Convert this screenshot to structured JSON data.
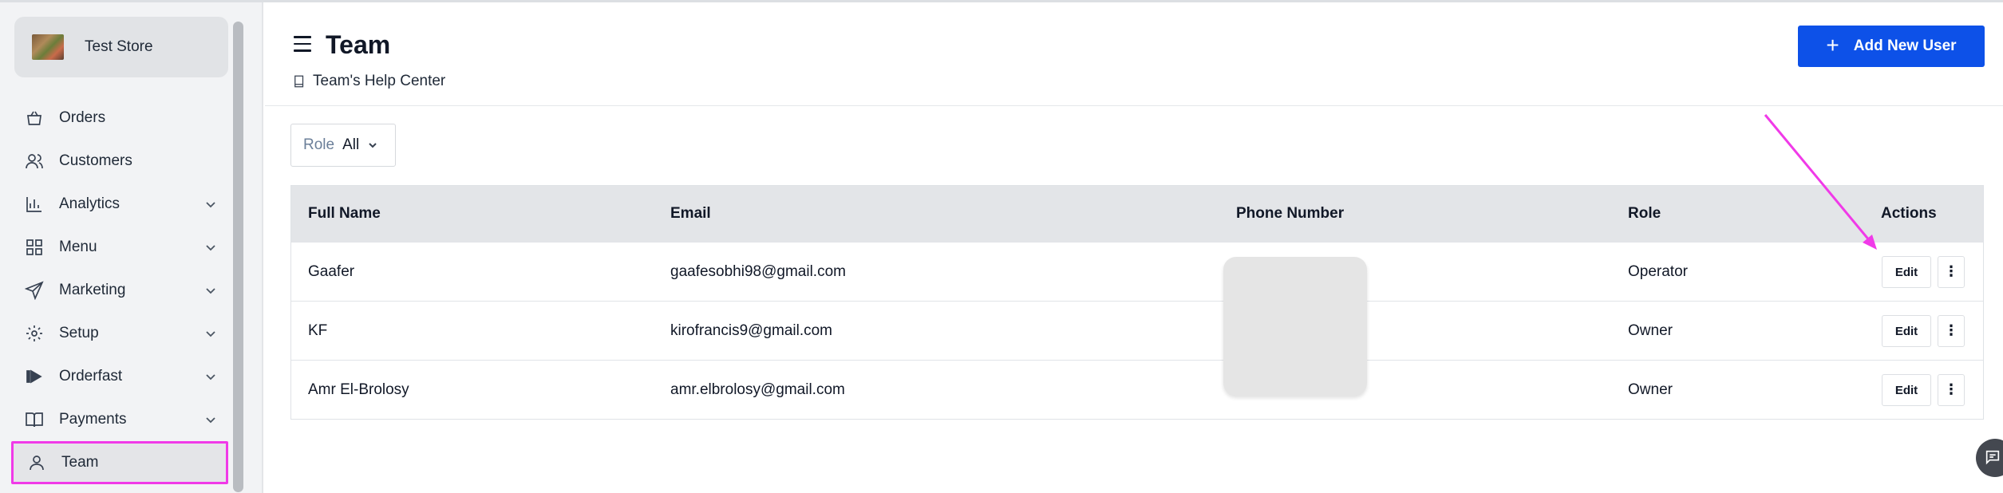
{
  "store": {
    "name": "Test Store"
  },
  "sidebar": {
    "items": [
      {
        "label": "Orders",
        "icon": "shopping-bag-icon",
        "chevron": false
      },
      {
        "label": "Customers",
        "icon": "users-icon",
        "chevron": false
      },
      {
        "label": "Analytics",
        "icon": "bar-chart-icon",
        "chevron": true
      },
      {
        "label": "Menu",
        "icon": "grid-icon",
        "chevron": true
      },
      {
        "label": "Marketing",
        "icon": "send-icon",
        "chevron": true
      },
      {
        "label": "Setup",
        "icon": "gear-icon",
        "chevron": true
      },
      {
        "label": "Orderfast",
        "icon": "play-icon",
        "chevron": true
      },
      {
        "label": "Payments",
        "icon": "book-icon",
        "chevron": true
      },
      {
        "label": "Team",
        "icon": "user-icon",
        "chevron": false,
        "active": true
      }
    ]
  },
  "header": {
    "title": "Team",
    "help_link": "Team's Help Center",
    "add_button": "Add New User",
    "add_button_color": "#0d51e8"
  },
  "filter": {
    "key": "Role",
    "value": "All"
  },
  "table": {
    "columns": [
      "Full Name",
      "Email",
      "Phone Number",
      "Role",
      "Actions"
    ],
    "rows": [
      {
        "name": "Gaafer",
        "email": "gaafesobhi98@gmail.com",
        "phone": "",
        "role": "Operator",
        "edit": "Edit",
        "more": "⋮"
      },
      {
        "name": "KF",
        "email": "kirofrancis9@gmail.com",
        "phone": "",
        "role": "Owner",
        "edit": "Edit",
        "more": "⋮"
      },
      {
        "name": "Amr El-Brolosy",
        "email": "amr.elbrolosy@gmail.com",
        "phone": "",
        "role": "Owner",
        "edit": "Edit",
        "more": "⋮"
      }
    ]
  },
  "annotation": {
    "highlight_color": "#f03ae8"
  }
}
